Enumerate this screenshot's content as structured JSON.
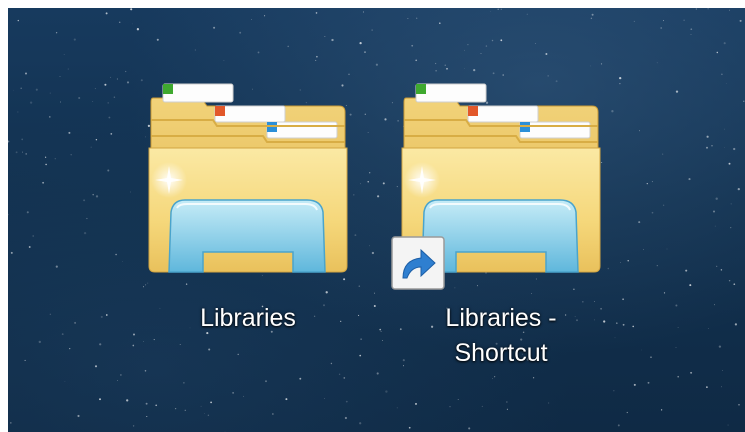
{
  "desktop": {
    "icons": [
      {
        "label": "Libraries",
        "type": "library-folder",
        "shortcut": false
      },
      {
        "label_line1": "Libraries -",
        "label_line2": "Shortcut",
        "type": "library-folder",
        "shortcut": true
      }
    ]
  },
  "icon_names": {
    "folder": "libraries-folder-icon",
    "shortcut_overlay": "shortcut-arrow-icon"
  },
  "colors": {
    "wallpaper": "#12314f",
    "folder_front": "#f7d97a",
    "folder_back": "#e9c15b",
    "glass_blue": "#8fd2ea",
    "tab_green": "#3fa92f",
    "tab_orange": "#e2582a",
    "tab_blue": "#2b8fd8",
    "label_text": "#ffffff"
  }
}
